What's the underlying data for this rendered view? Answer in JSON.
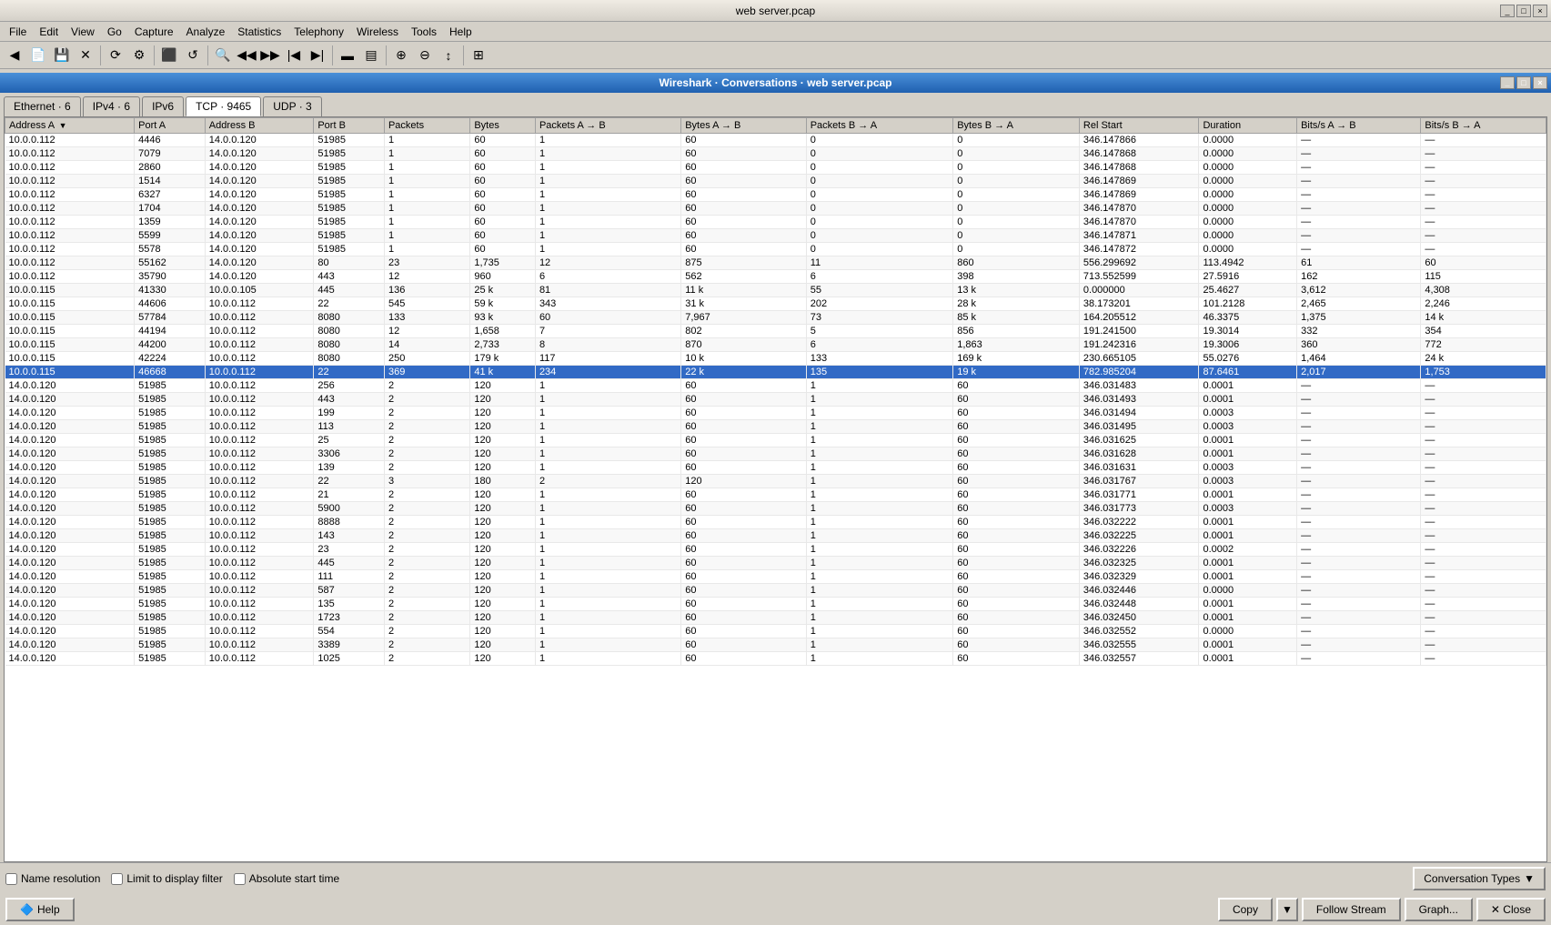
{
  "app": {
    "title": "web server.pcap",
    "conv_title": "Wireshark · Conversations · web server.pcap"
  },
  "menu": {
    "items": [
      "File",
      "Edit",
      "View",
      "Go",
      "Capture",
      "Analyze",
      "Statistics",
      "Telephony",
      "Wireless",
      "Tools",
      "Help"
    ]
  },
  "tabs": [
    {
      "label": "Ethernet · 6",
      "active": false
    },
    {
      "label": "IPv4 · 6",
      "active": false
    },
    {
      "label": "IPv6",
      "active": false
    },
    {
      "label": "TCP · 9465",
      "active": true
    },
    {
      "label": "UDP · 3",
      "active": false
    }
  ],
  "columns": [
    {
      "label": "Address A",
      "sort": "▼"
    },
    {
      "label": "Port A"
    },
    {
      "label": "Address B"
    },
    {
      "label": "Port B"
    },
    {
      "label": "Packets"
    },
    {
      "label": "Bytes"
    },
    {
      "label": "Packets A → B"
    },
    {
      "label": "Bytes A → B"
    },
    {
      "label": "Packets B → A"
    },
    {
      "label": "Bytes B → A"
    },
    {
      "label": "Rel Start"
    },
    {
      "label": "Duration"
    },
    {
      "label": "Bits/s A → B"
    },
    {
      "label": "Bits/s B → A"
    }
  ],
  "rows": [
    [
      "10.0.0.112",
      "4446",
      "14.0.0.120",
      "51985",
      "1",
      "60",
      "1",
      "60",
      "0",
      "0",
      "346.147866",
      "0.0000",
      "—",
      "—"
    ],
    [
      "10.0.0.112",
      "7079",
      "14.0.0.120",
      "51985",
      "1",
      "60",
      "1",
      "60",
      "0",
      "0",
      "346.147868",
      "0.0000",
      "—",
      "—"
    ],
    [
      "10.0.0.112",
      "2860",
      "14.0.0.120",
      "51985",
      "1",
      "60",
      "1",
      "60",
      "0",
      "0",
      "346.147868",
      "0.0000",
      "—",
      "—"
    ],
    [
      "10.0.0.112",
      "1514",
      "14.0.0.120",
      "51985",
      "1",
      "60",
      "1",
      "60",
      "0",
      "0",
      "346.147869",
      "0.0000",
      "—",
      "—"
    ],
    [
      "10.0.0.112",
      "6327",
      "14.0.0.120",
      "51985",
      "1",
      "60",
      "1",
      "60",
      "0",
      "0",
      "346.147869",
      "0.0000",
      "—",
      "—"
    ],
    [
      "10.0.0.112",
      "1704",
      "14.0.0.120",
      "51985",
      "1",
      "60",
      "1",
      "60",
      "0",
      "0",
      "346.147870",
      "0.0000",
      "—",
      "—"
    ],
    [
      "10.0.0.112",
      "1359",
      "14.0.0.120",
      "51985",
      "1",
      "60",
      "1",
      "60",
      "0",
      "0",
      "346.147870",
      "0.0000",
      "—",
      "—"
    ],
    [
      "10.0.0.112",
      "5599",
      "14.0.0.120",
      "51985",
      "1",
      "60",
      "1",
      "60",
      "0",
      "0",
      "346.147871",
      "0.0000",
      "—",
      "—"
    ],
    [
      "10.0.0.112",
      "5578",
      "14.0.0.120",
      "51985",
      "1",
      "60",
      "1",
      "60",
      "0",
      "0",
      "346.147872",
      "0.0000",
      "—",
      "—"
    ],
    [
      "10.0.0.112",
      "55162",
      "14.0.0.120",
      "80",
      "23",
      "1,735",
      "12",
      "875",
      "11",
      "860",
      "556.299692",
      "113.4942",
      "61",
      "60"
    ],
    [
      "10.0.0.112",
      "35790",
      "14.0.0.120",
      "443",
      "12",
      "960",
      "6",
      "562",
      "6",
      "398",
      "713.552599",
      "27.5916",
      "162",
      "115"
    ],
    [
      "10.0.0.115",
      "41330",
      "10.0.0.105",
      "445",
      "136",
      "25 k",
      "81",
      "11 k",
      "55",
      "13 k",
      "0.000000",
      "25.4627",
      "3,612",
      "4,308"
    ],
    [
      "10.0.0.115",
      "44606",
      "10.0.0.112",
      "22",
      "545",
      "59 k",
      "343",
      "31 k",
      "202",
      "28 k",
      "38.173201",
      "101.2128",
      "2,465",
      "2,246"
    ],
    [
      "10.0.0.115",
      "57784",
      "10.0.0.112",
      "8080",
      "133",
      "93 k",
      "60",
      "7,967",
      "73",
      "85 k",
      "164.205512",
      "46.3375",
      "1,375",
      "14 k"
    ],
    [
      "10.0.0.115",
      "44194",
      "10.0.0.112",
      "8080",
      "12",
      "1,658",
      "7",
      "802",
      "5",
      "856",
      "191.241500",
      "19.3014",
      "332",
      "354"
    ],
    [
      "10.0.0.115",
      "44200",
      "10.0.0.112",
      "8080",
      "14",
      "2,733",
      "8",
      "870",
      "6",
      "1,863",
      "191.242316",
      "19.3006",
      "360",
      "772"
    ],
    [
      "10.0.0.115",
      "42224",
      "10.0.0.112",
      "8080",
      "250",
      "179 k",
      "117",
      "10 k",
      "133",
      "169 k",
      "230.665105",
      "55.0276",
      "1,464",
      "24 k"
    ],
    [
      "10.0.0.115",
      "46668",
      "10.0.0.112",
      "22",
      "369",
      "41 k",
      "234",
      "22 k",
      "135",
      "19 k",
      "782.985204",
      "87.6461",
      "2,017",
      "1,753"
    ],
    [
      "14.0.0.120",
      "51985",
      "10.0.0.112",
      "256",
      "2",
      "120",
      "1",
      "60",
      "1",
      "60",
      "346.031483",
      "0.0001",
      "—",
      "—"
    ],
    [
      "14.0.0.120",
      "51985",
      "10.0.0.112",
      "443",
      "2",
      "120",
      "1",
      "60",
      "1",
      "60",
      "346.031493",
      "0.0001",
      "—",
      "—"
    ],
    [
      "14.0.0.120",
      "51985",
      "10.0.0.112",
      "199",
      "2",
      "120",
      "1",
      "60",
      "1",
      "60",
      "346.031494",
      "0.0003",
      "—",
      "—"
    ],
    [
      "14.0.0.120",
      "51985",
      "10.0.0.112",
      "113",
      "2",
      "120",
      "1",
      "60",
      "1",
      "60",
      "346.031495",
      "0.0003",
      "—",
      "—"
    ],
    [
      "14.0.0.120",
      "51985",
      "10.0.0.112",
      "25",
      "2",
      "120",
      "1",
      "60",
      "1",
      "60",
      "346.031625",
      "0.0001",
      "—",
      "—"
    ],
    [
      "14.0.0.120",
      "51985",
      "10.0.0.112",
      "3306",
      "2",
      "120",
      "1",
      "60",
      "1",
      "60",
      "346.031628",
      "0.0001",
      "—",
      "—"
    ],
    [
      "14.0.0.120",
      "51985",
      "10.0.0.112",
      "139",
      "2",
      "120",
      "1",
      "60",
      "1",
      "60",
      "346.031631",
      "0.0003",
      "—",
      "—"
    ],
    [
      "14.0.0.120",
      "51985",
      "10.0.0.112",
      "22",
      "3",
      "180",
      "2",
      "120",
      "1",
      "60",
      "346.031767",
      "0.0003",
      "—",
      "—"
    ],
    [
      "14.0.0.120",
      "51985",
      "10.0.0.112",
      "21",
      "2",
      "120",
      "1",
      "60",
      "1",
      "60",
      "346.031771",
      "0.0001",
      "—",
      "—"
    ],
    [
      "14.0.0.120",
      "51985",
      "10.0.0.112",
      "5900",
      "2",
      "120",
      "1",
      "60",
      "1",
      "60",
      "346.031773",
      "0.0003",
      "—",
      "—"
    ],
    [
      "14.0.0.120",
      "51985",
      "10.0.0.112",
      "8888",
      "2",
      "120",
      "1",
      "60",
      "1",
      "60",
      "346.032222",
      "0.0001",
      "—",
      "—"
    ],
    [
      "14.0.0.120",
      "51985",
      "10.0.0.112",
      "143",
      "2",
      "120",
      "1",
      "60",
      "1",
      "60",
      "346.032225",
      "0.0001",
      "—",
      "—"
    ],
    [
      "14.0.0.120",
      "51985",
      "10.0.0.112",
      "23",
      "2",
      "120",
      "1",
      "60",
      "1",
      "60",
      "346.032226",
      "0.0002",
      "—",
      "—"
    ],
    [
      "14.0.0.120",
      "51985",
      "10.0.0.112",
      "445",
      "2",
      "120",
      "1",
      "60",
      "1",
      "60",
      "346.032325",
      "0.0001",
      "—",
      "—"
    ],
    [
      "14.0.0.120",
      "51985",
      "10.0.0.112",
      "111",
      "2",
      "120",
      "1",
      "60",
      "1",
      "60",
      "346.032329",
      "0.0001",
      "—",
      "—"
    ],
    [
      "14.0.0.120",
      "51985",
      "10.0.0.112",
      "587",
      "2",
      "120",
      "1",
      "60",
      "1",
      "60",
      "346.032446",
      "0.0000",
      "—",
      "—"
    ],
    [
      "14.0.0.120",
      "51985",
      "10.0.0.112",
      "135",
      "2",
      "120",
      "1",
      "60",
      "1",
      "60",
      "346.032448",
      "0.0001",
      "—",
      "—"
    ],
    [
      "14.0.0.120",
      "51985",
      "10.0.0.112",
      "1723",
      "2",
      "120",
      "1",
      "60",
      "1",
      "60",
      "346.032450",
      "0.0001",
      "—",
      "—"
    ],
    [
      "14.0.0.120",
      "51985",
      "10.0.0.112",
      "554",
      "2",
      "120",
      "1",
      "60",
      "1",
      "60",
      "346.032552",
      "0.0000",
      "—",
      "—"
    ],
    [
      "14.0.0.120",
      "51985",
      "10.0.0.112",
      "3389",
      "2",
      "120",
      "1",
      "60",
      "1",
      "60",
      "346.032555",
      "0.0001",
      "—",
      "—"
    ],
    [
      "14.0.0.120",
      "51985",
      "10.0.0.112",
      "1025",
      "2",
      "120",
      "1",
      "60",
      "1",
      "60",
      "346.032557",
      "0.0001",
      "—",
      "—"
    ]
  ],
  "bottom": {
    "name_resolution": "Name resolution",
    "limit_filter": "Limit to display filter",
    "absolute_time": "Absolute start time"
  },
  "buttons": {
    "help": "Help",
    "copy": "Copy",
    "follow_stream": "Follow Stream",
    "graph": "Graph...",
    "close": "✕ Close",
    "conv_types": "Conversation Types"
  }
}
